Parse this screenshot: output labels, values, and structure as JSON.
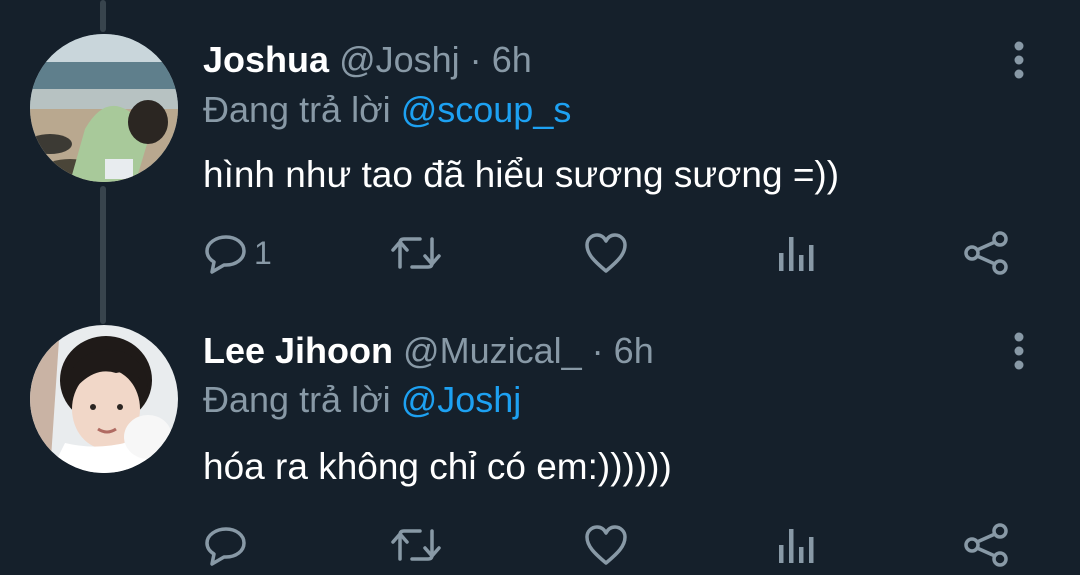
{
  "tweets": [
    {
      "name": "Joshua",
      "handle": "@Joshj",
      "separator": "·",
      "time": "6h",
      "reply_prefix": "Đang trả lời",
      "reply_to": "@scoup_s",
      "text": "hình như tao đã hiểu sương sương =))",
      "reply_count": "1"
    },
    {
      "name": "Lee Jihoon",
      "handle": "@Muzical_",
      "separator": "·",
      "time": "6h",
      "reply_prefix": "Đang trả lời",
      "reply_to": "@Joshj",
      "text": "hóa ra không chỉ có em:))))))",
      "reply_count": ""
    }
  ],
  "icons": {
    "reply": "reply-icon",
    "retweet": "retweet-icon",
    "like": "heart-icon",
    "analytics": "analytics-icon",
    "share": "share-icon",
    "more": "more-vertical-icon"
  },
  "colors": {
    "background": "#15202b",
    "secondary_text": "#8899a6",
    "mention": "#1da1f2",
    "thread_line": "#38444d"
  }
}
